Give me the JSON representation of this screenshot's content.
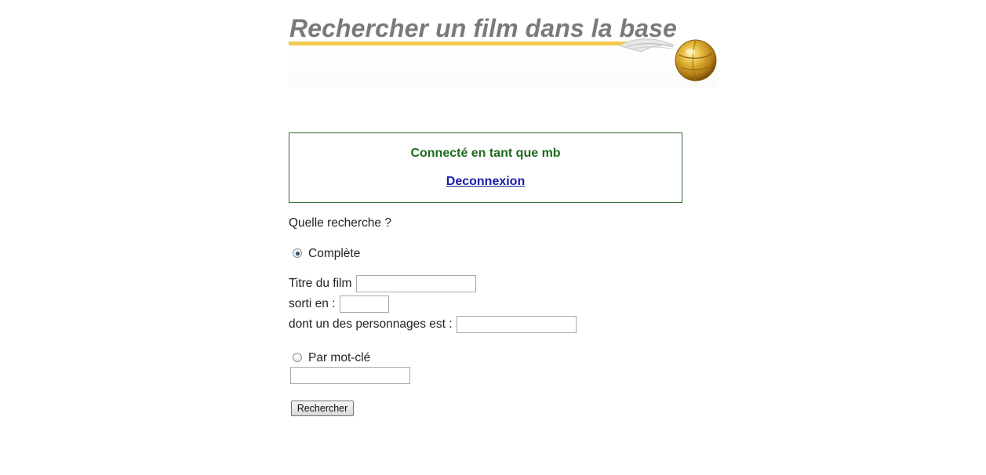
{
  "header": {
    "title": "Rechercher un film dans la base",
    "icon": "golden-snitch-icon",
    "accent_color": "#f2c94c"
  },
  "login": {
    "status": "Connecté en tant que mb",
    "logout_label": "Deconnexion",
    "status_color": "#1f6a1f",
    "link_color": "#1a1aa6"
  },
  "search": {
    "question": "Quelle recherche ?",
    "complete": {
      "label": "Complète",
      "checked": true
    },
    "title_field": {
      "label": "Titre du film",
      "value": ""
    },
    "year_field": {
      "label": "sorti en :",
      "value": ""
    },
    "character_field": {
      "label": "dont un des personnages est :",
      "value": ""
    },
    "keyword": {
      "label": "Par mot-clé",
      "checked": false,
      "value": ""
    },
    "submit_label": "Rechercher"
  }
}
